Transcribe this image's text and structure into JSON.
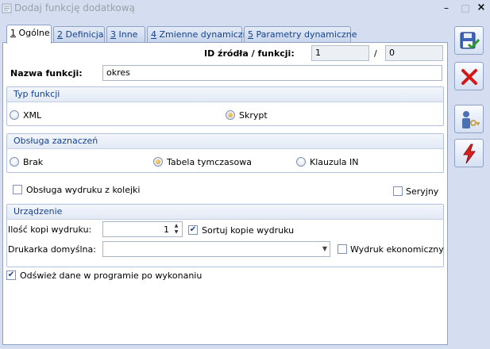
{
  "window": {
    "title": "Dodaj funkcję dodatkową",
    "minimize": "–",
    "maximize": "□",
    "close": "×"
  },
  "tabs": [
    {
      "num": "1",
      "label": " Ogólne"
    },
    {
      "num": "2",
      "label": " Definicja"
    },
    {
      "num": "3",
      "label": " Inne"
    },
    {
      "num": "4",
      "label": " Zmienne dynamiczne"
    },
    {
      "num": "5",
      "label": " Parametry dynamiczne"
    }
  ],
  "header": {
    "id_label": "ID źródła / funkcji:",
    "id_source": "1",
    "id_separator": "/",
    "id_function": "0",
    "name_label": "Nazwa funkcji:",
    "name_value": "okres"
  },
  "typ_funkcji": {
    "title": "Typ funkcji",
    "options": [
      {
        "label": "XML",
        "selected": false
      },
      {
        "label": "Skrypt",
        "selected": true
      }
    ]
  },
  "obsluga_zaznaczen": {
    "title": "Obsługa zaznaczeń",
    "options": [
      {
        "label": "Brak",
        "selected": false
      },
      {
        "label": "Tabela tymczasowa",
        "selected": true
      },
      {
        "label": "Klauzula IN",
        "selected": false
      }
    ]
  },
  "obsluga_wydruku": {
    "label": "Obsługa wydruku z kolejki",
    "checked": false
  },
  "seryjny": {
    "label": "Seryjny",
    "checked": false
  },
  "urzadzenie": {
    "title": "Urządzenie",
    "copies_label": "Ilość kopi wydruku:",
    "copies_value": "1",
    "sort_label": "Sortuj kopie wydruku",
    "sort_checked": true,
    "printer_label": "Drukarka domyślna:",
    "printer_value": "",
    "eco_label": "Wydruk ekonomiczny",
    "eco_checked": false
  },
  "refresh": {
    "label": "Odśwież dane w programie po wykonaniu",
    "checked": true
  },
  "toolbar": {
    "icons": [
      "save-icon",
      "cancel-icon",
      "user-key-icon",
      "lightning-icon"
    ]
  }
}
